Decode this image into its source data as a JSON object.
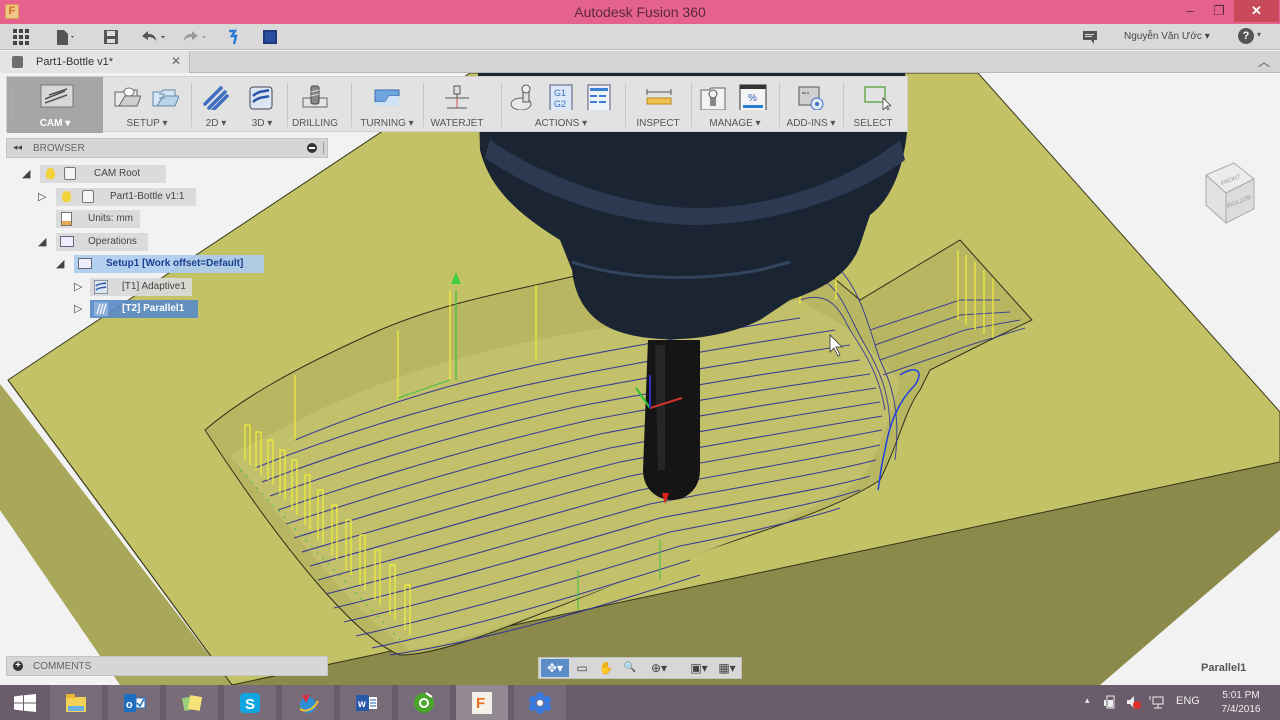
{
  "window": {
    "title": "Autodesk Fusion 360",
    "app_logo_letter": "F",
    "minimize_glyph": "–",
    "restore_glyph": "❐",
    "close_glyph": "✕"
  },
  "quick_access": {
    "items": [
      {
        "name": "data-panel-grid-icon"
      },
      {
        "name": "file-menu-icon"
      },
      {
        "name": "save-icon"
      },
      {
        "name": "undo-icon"
      },
      {
        "name": "redo-icon"
      },
      {
        "name": "job-status-icon"
      },
      {
        "name": "cloud-data-icon"
      }
    ],
    "user_name": "Nguyễn Văn Ước ▾",
    "help_glyph": "?",
    "help_caret": "▾"
  },
  "document_tab": {
    "label": "Part1-Bottle v1*",
    "close_glyph": "✕",
    "collapse_glyph": "︿"
  },
  "ribbon": {
    "groups": [
      {
        "id": "cam",
        "label": "CAM ▾"
      },
      {
        "id": "setup",
        "label": "SETUP ▾"
      },
      {
        "id": "2d",
        "label": "2D ▾"
      },
      {
        "id": "3d",
        "label": "3D ▾"
      },
      {
        "id": "drilling",
        "label": "DRILLING"
      },
      {
        "id": "turning",
        "label": "TURNING ▾"
      },
      {
        "id": "waterjet",
        "label": "WATERJET"
      },
      {
        "id": "actions",
        "label": "ACTIONS ▾"
      },
      {
        "id": "inspect",
        "label": "INSPECT"
      },
      {
        "id": "manage",
        "label": "MANAGE ▾"
      },
      {
        "id": "addins",
        "label": "ADD-INS ▾"
      },
      {
        "id": "select",
        "label": "SELECT"
      }
    ],
    "g1g2_text_line1": "G1",
    "g1g2_text_line2": "G2",
    "percent_text": "%"
  },
  "browser": {
    "title": "BROWSER",
    "collapse_glyph": "◂◂",
    "tree": [
      {
        "label": "CAM Root",
        "expanded": true
      },
      {
        "label": "Part1-Bottle v1:1",
        "expanded": false
      },
      {
        "label": "Units: mm"
      },
      {
        "label": "Operations",
        "expanded": true
      },
      {
        "label": "Setup1 [Work offset=Default]",
        "expanded": true,
        "state": "highlighted"
      },
      {
        "label": "[T1] Adaptive1",
        "expanded": false
      },
      {
        "label": "[T2] Parallel1",
        "expanded": false,
        "state": "selected"
      }
    ]
  },
  "comments": {
    "title": "COMMENTS",
    "plus_glyph": "+"
  },
  "navigation_bar": {
    "items": [
      {
        "name": "orbit-icon",
        "glyph": "✥▾",
        "active": true
      },
      {
        "name": "look-at-icon",
        "glyph": "▭"
      },
      {
        "name": "pan-icon",
        "glyph": "✋"
      },
      {
        "name": "zoom-icon",
        "glyph": "🔍"
      },
      {
        "name": "zoom-window-icon",
        "glyph": "⊕▾"
      },
      {
        "name": "display-settings-icon",
        "glyph": "▣▾"
      },
      {
        "name": "grid-settings-icon",
        "glyph": "▦▾"
      }
    ]
  },
  "viewcube": {
    "front_label": "FRONT",
    "bottom_label": "BOTTOM"
  },
  "status": {
    "active_operation": "Parallel1"
  },
  "scene": {
    "stock_color": "#c4c266",
    "stock_side_color": "#8b8a4a",
    "toolpath_cut_color": "#2c2f9a",
    "toolpath_rapid_color": "#f0f03a",
    "toolpath_link_color": "#3fbf3f",
    "tool_color": "#1a2433"
  },
  "taskbar": {
    "apps": [
      {
        "name": "file-explorer-icon"
      },
      {
        "name": "outlook-icon"
      },
      {
        "name": "sticky-notes-icon"
      },
      {
        "name": "skype-icon"
      },
      {
        "name": "network-app-icon"
      },
      {
        "name": "word-icon"
      },
      {
        "name": "coccoc-browser-icon"
      },
      {
        "name": "fusion360-icon",
        "active": true
      },
      {
        "name": "flower-app-icon"
      }
    ],
    "tray_caret": "▴",
    "language": "ENG",
    "time": "5:01 PM",
    "date": "7/4/2016"
  }
}
